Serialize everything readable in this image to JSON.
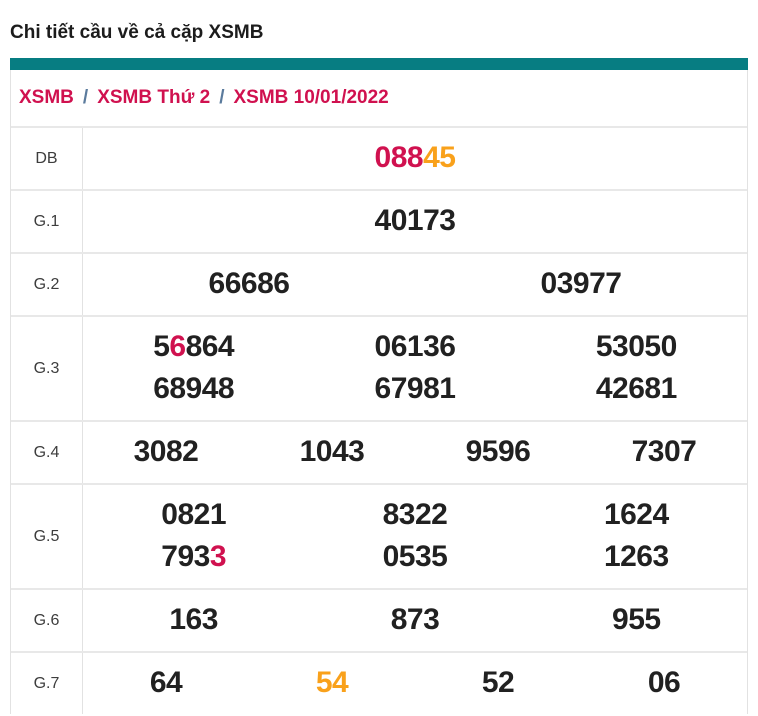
{
  "page": {
    "title": "Chi tiết cầu về cả cặp XSMB"
  },
  "breadcrumb": {
    "separator": "/",
    "items": [
      "XSMB",
      "XSMB Thứ 2",
      "XSMB 10/01/2022"
    ]
  },
  "colors": {
    "accent_teal": "#077d82",
    "crimson": "#d0114f",
    "orange": "#f9a11b",
    "number_black": "#212121",
    "separator_slate": "#5b7b9d"
  },
  "results_table": {
    "rows": [
      {
        "label": "DB",
        "columns": 1,
        "lines": [
          [
            [
              {
                "t": "088",
                "c": "crimson"
              },
              {
                "t": "45",
                "c": "orange"
              }
            ]
          ]
        ]
      },
      {
        "label": "G.1",
        "columns": 1,
        "lines": [
          [
            [
              {
                "t": "40173"
              }
            ]
          ]
        ]
      },
      {
        "label": "G.2",
        "columns": 2,
        "lines": [
          [
            [
              {
                "t": "66686"
              }
            ],
            [
              {
                "t": "03977"
              }
            ]
          ]
        ]
      },
      {
        "label": "G.3",
        "columns": 3,
        "lines": [
          [
            [
              {
                "t": "5"
              },
              {
                "t": "6",
                "c": "crimson"
              },
              {
                "t": "864"
              }
            ],
            [
              {
                "t": "06136"
              }
            ],
            [
              {
                "t": "53050"
              }
            ]
          ],
          [
            [
              {
                "t": "68948"
              }
            ],
            [
              {
                "t": "67981"
              }
            ],
            [
              {
                "t": "42681"
              }
            ]
          ]
        ]
      },
      {
        "label": "G.4",
        "columns": 4,
        "lines": [
          [
            [
              {
                "t": "3082"
              }
            ],
            [
              {
                "t": "1043"
              }
            ],
            [
              {
                "t": "9596"
              }
            ],
            [
              {
                "t": "7307"
              }
            ]
          ]
        ]
      },
      {
        "label": "G.5",
        "columns": 3,
        "lines": [
          [
            [
              {
                "t": "0821"
              }
            ],
            [
              {
                "t": "8322"
              }
            ],
            [
              {
                "t": "1624"
              }
            ]
          ],
          [
            [
              {
                "t": "793"
              },
              {
                "t": "3",
                "c": "crimson"
              }
            ],
            [
              {
                "t": "0535"
              }
            ],
            [
              {
                "t": "1263"
              }
            ]
          ]
        ]
      },
      {
        "label": "G.6",
        "columns": 3,
        "lines": [
          [
            [
              {
                "t": "163"
              }
            ],
            [
              {
                "t": "873"
              }
            ],
            [
              {
                "t": "955"
              }
            ]
          ]
        ]
      },
      {
        "label": "G.7",
        "columns": 4,
        "lines": [
          [
            [
              {
                "t": "64"
              }
            ],
            [
              {
                "t": "54",
                "c": "orange"
              }
            ],
            [
              {
                "t": "52"
              }
            ],
            [
              {
                "t": "06"
              }
            ]
          ]
        ]
      }
    ]
  }
}
